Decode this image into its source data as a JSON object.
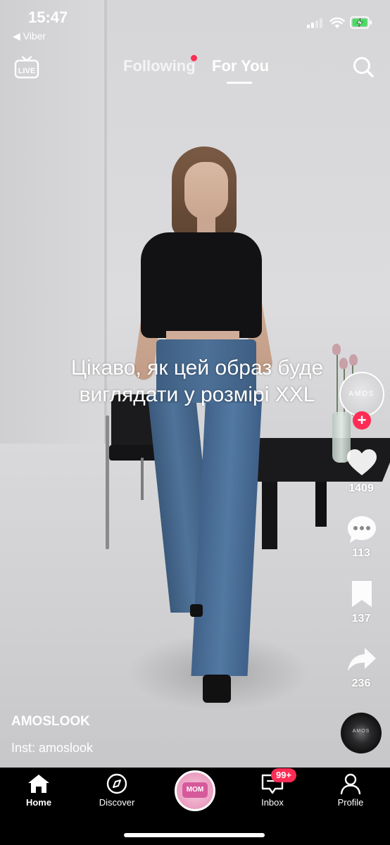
{
  "status_bar": {
    "time": "15:47",
    "back_app": "◀ Viber"
  },
  "top_nav": {
    "live_label": "LIVE",
    "tabs": [
      {
        "label": "Following",
        "has_dot": true
      },
      {
        "label": "For You",
        "active": true
      }
    ],
    "search_icon": "search-icon"
  },
  "video": {
    "caption": "Цікаво, як цей образ буде виглядати у розмірі XXL",
    "author": "AMOSLOOK",
    "description": "Inst: amoslook"
  },
  "actions": {
    "avatar_text": "AMOS",
    "likes": "1409",
    "comments": "113",
    "bookmarks": "137",
    "shares": "236",
    "disc_text": "AMOS"
  },
  "bottom_nav": {
    "items": [
      {
        "label": "Home",
        "icon": "home-icon",
        "active": true
      },
      {
        "label": "Discover",
        "icon": "compass-icon"
      },
      {
        "label": "",
        "icon": "create-icon"
      },
      {
        "label": "Inbox",
        "icon": "inbox-icon",
        "badge": "99+"
      },
      {
        "label": "Profile",
        "icon": "profile-icon"
      }
    ],
    "create_label": "MOM"
  },
  "colors": {
    "accent": "#fe2c55",
    "background": "#000000",
    "text": "#ffffff"
  }
}
